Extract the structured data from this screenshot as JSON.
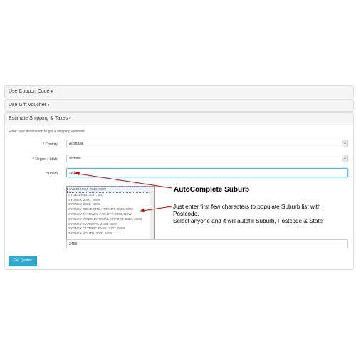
{
  "panels": {
    "coupon": {
      "title": "Use Coupon Code",
      "caret": "▾"
    },
    "voucher": {
      "title": "Use Gift Voucher",
      "caret": "▾"
    },
    "shipping": {
      "title": "Estimate Shipping & Taxes",
      "caret": "▾"
    }
  },
  "form": {
    "intro": "Enter your destination to get a shipping estimate.",
    "country": {
      "label": "Country",
      "value": "Australia"
    },
    "region": {
      "label": "Region / State",
      "value": "Victoria"
    },
    "suburb": {
      "label": "Suburb",
      "value": "syd"
    },
    "autocomplete": [
      "SYDENHAM, 2044, NSW",
      "SYDENHAM, 3037, VIC",
      "SYDNEY, 2000, NSW",
      "SYDNEY, 2001, NSW",
      "SYDNEY DOMESTIC AIRPORT, 2020, NSW",
      "SYDNEY GATEWAY FACILITY, 2891, NSW",
      "SYDNEY INTERNATIONAL AIRPORT, 2020, NSW",
      "SYDNEY MARKETS, 2129, NSW",
      "SYDNEY OLYMPIC PARK, 2127, NSW",
      "SYDNEY SOUTH, 2000, NSW"
    ],
    "postcode": "3458",
    "get_quotes": "Get Quotes"
  },
  "annotation": {
    "title": "AutoComplete Suburb",
    "line1": "Just enter first few characters to populate Suburb list with Postcode.",
    "line2": "Select anyone and it will autofill Suburb, Postcode & State"
  },
  "colors": {
    "accent": "#2aabd2",
    "annotation_arrow": "#cc0000",
    "required": "#cc0000"
  }
}
